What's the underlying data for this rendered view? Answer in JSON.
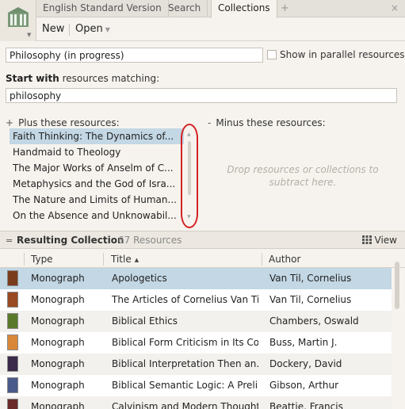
{
  "tabs": [
    {
      "label": "English Standard Version"
    },
    {
      "label": "Search"
    },
    {
      "label": "Collections"
    }
  ],
  "tab_plus": "+",
  "tab_close": "×",
  "toolbar": {
    "new_label": "New",
    "open_label": "Open"
  },
  "collection_name": "Philosophy (in progress)",
  "parallel": {
    "label": "Show in parallel resources",
    "checked": false
  },
  "start": {
    "bold": "Start with",
    "rest": " resources matching:"
  },
  "match_value": "philosophy",
  "plus": {
    "symbol": "+",
    "title": "Plus these resources:",
    "items": [
      "Faith Thinking: The Dynamics of...",
      "Handmaid to Theology",
      "The Major Works of Anselm of C...",
      "Metaphysics and the God of Isra...",
      "The Nature and Limits of Human...",
      "On the Absence and Unknowabil..."
    ],
    "selected_index": 0
  },
  "minus": {
    "symbol": "-",
    "title": "Minus these resources:",
    "hint": "Drop resources or collections to subtract here."
  },
  "result": {
    "symbol": "=",
    "title": "Resulting Collection",
    "count": "67 Resources",
    "view_label": "View"
  },
  "columns": {
    "type": "Type",
    "title": "Title",
    "author": "Author"
  },
  "rows": [
    {
      "type": "Monograph",
      "title": "Apologetics",
      "author": "Van Til, Cornelius",
      "cover": "#7a3b1c"
    },
    {
      "type": "Monograph",
      "title": "The Articles of Cornelius Van Til",
      "author": "Van Til, Cornelius",
      "cover": "#9a4a22"
    },
    {
      "type": "Monograph",
      "title": "Biblical Ethics",
      "author": "Chambers, Oswald",
      "cover": "#5a7a2a"
    },
    {
      "type": "Monograph",
      "title": "Biblical Form Criticism in Its Co...",
      "author": "Buss, Martin J.",
      "cover": "#d9883a"
    },
    {
      "type": "Monograph",
      "title": "Biblical Interpretation Then an...",
      "author": "Dockery, David",
      "cover": "#3b2a4a"
    },
    {
      "type": "Monograph",
      "title": "Biblical Semantic Logic: A Preli...",
      "author": "Gibson, Arthur",
      "cover": "#4a5a8a"
    },
    {
      "type": "Monograph",
      "title": "Calvinism and Modern Thought",
      "author": "Beattie, Francis",
      "cover": "#6a2a2a"
    }
  ],
  "selected_row": 0,
  "colors": {
    "selection": "#c3d7e4",
    "annotation": "#d42222",
    "hint": "#b4afa6"
  }
}
